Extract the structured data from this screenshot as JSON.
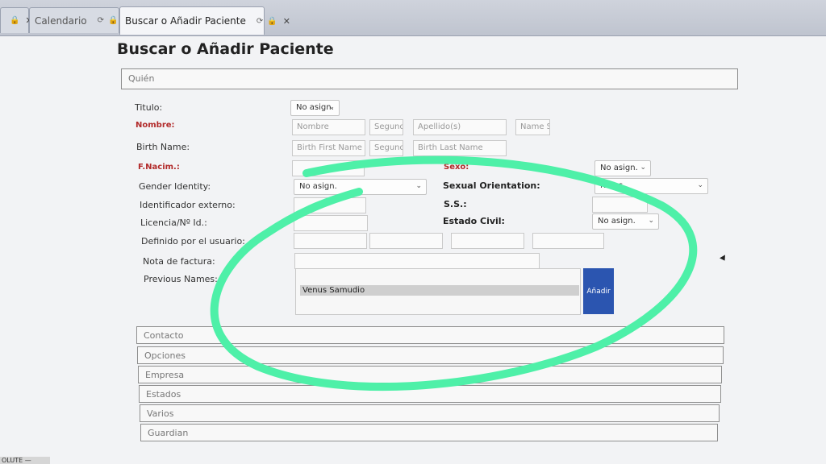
{
  "tabs": [
    {
      "label": ""
    },
    {
      "label": "Calendario"
    },
    {
      "label": "Buscar o Añadir Paciente"
    }
  ],
  "page": {
    "title": "Buscar o Añadir Paciente"
  },
  "section": {
    "label": "Quién"
  },
  "form": {
    "titulo": {
      "label": "Titulo:",
      "value": "No asign."
    },
    "nombre": {
      "label": "Nombre:",
      "placeholders": [
        "Nombre",
        "Segundo",
        "Apellido(s)",
        "Name Su"
      ]
    },
    "birth_name": {
      "label": "Birth Name:",
      "placeholders": [
        "Birth First Name",
        "Segundo",
        "Birth Last Name"
      ]
    },
    "fnacim": {
      "label": "F.Nacim.:"
    },
    "sexo": {
      "label": "Sexo:",
      "value": "No asign."
    },
    "gender_identity": {
      "label": "Gender Identity:",
      "value": "No asign."
    },
    "sexual_orientation": {
      "label": "Sexual Orientation:",
      "value": "No as"
    },
    "identificador_externo": {
      "label": "Identificador externo:"
    },
    "ss": {
      "label": "S.S.:"
    },
    "licencia": {
      "label": "Licencia/Nº Id.:"
    },
    "estado_civil": {
      "label": "Estado Civil:",
      "value": "No asign."
    },
    "definido_usuario": {
      "label": "Definido por el usuario:"
    },
    "nota_factura": {
      "label": "Nota de factura:"
    },
    "previous_names": {
      "label": "Previous Names:",
      "items": [
        "Venus Samudio"
      ],
      "add_label": "Añadir"
    }
  },
  "accordions": [
    "Contacto",
    "Opciones",
    "Empresa",
    "Estados",
    "Varios",
    "Guardian"
  ],
  "status_text": "OLUTE —",
  "colors": {
    "accent": "#2b55b0",
    "required": "#b22a2a",
    "scribble": "#4ef0a8"
  }
}
